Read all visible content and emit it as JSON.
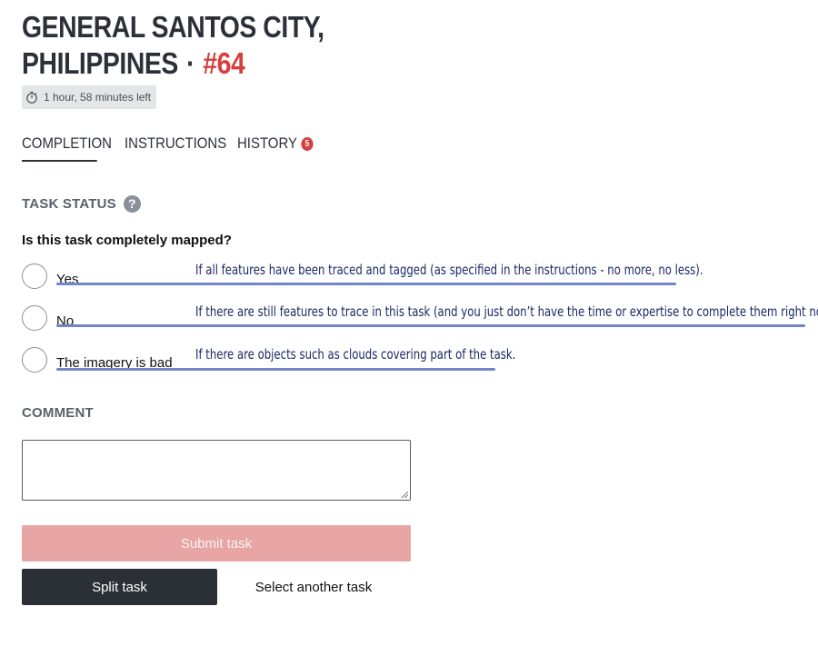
{
  "header": {
    "title_line1": "GENERAL SANTOS CITY,",
    "title_line2": "PHILIPPINES",
    "separator": "·",
    "task_number": "#64",
    "task_number_color": "#d73f3f",
    "time_left": "1 hour, 58 minutes left",
    "timer_icon": "stopwatch-icon"
  },
  "tabs": [
    {
      "label": "COMPLETION",
      "active": true
    },
    {
      "label": "INSTRUCTIONS",
      "active": false
    },
    {
      "label": "HISTORY",
      "active": false,
      "badge": "5"
    }
  ],
  "task_status": {
    "label": "TASK STATUS",
    "help_icon": "question-circle-icon",
    "question": "Is this task completely mapped?",
    "options": [
      {
        "label": "Yes",
        "note": "If all features have been traced and tagged (as specified in the instructions - no more, no less)."
      },
      {
        "label": "No",
        "note": "If there are still features to trace in this task (and you just don’t have the time or expertise to complete them right now)."
      },
      {
        "label": "The imagery is bad",
        "note": "If there are objects such as clouds covering part of the task."
      }
    ]
  },
  "comment": {
    "label": "COMMENT",
    "value": ""
  },
  "actions": {
    "submit_label": "Submit task",
    "split_label": "Split task",
    "select_another_label": "Select another task"
  },
  "colors": {
    "accent_red": "#d73f3f",
    "submit_disabled": "#e7a5a5",
    "dark_button": "#2b2f36",
    "annotation_blue": "#6f86c9",
    "annotation_text": "#1b2a66"
  }
}
